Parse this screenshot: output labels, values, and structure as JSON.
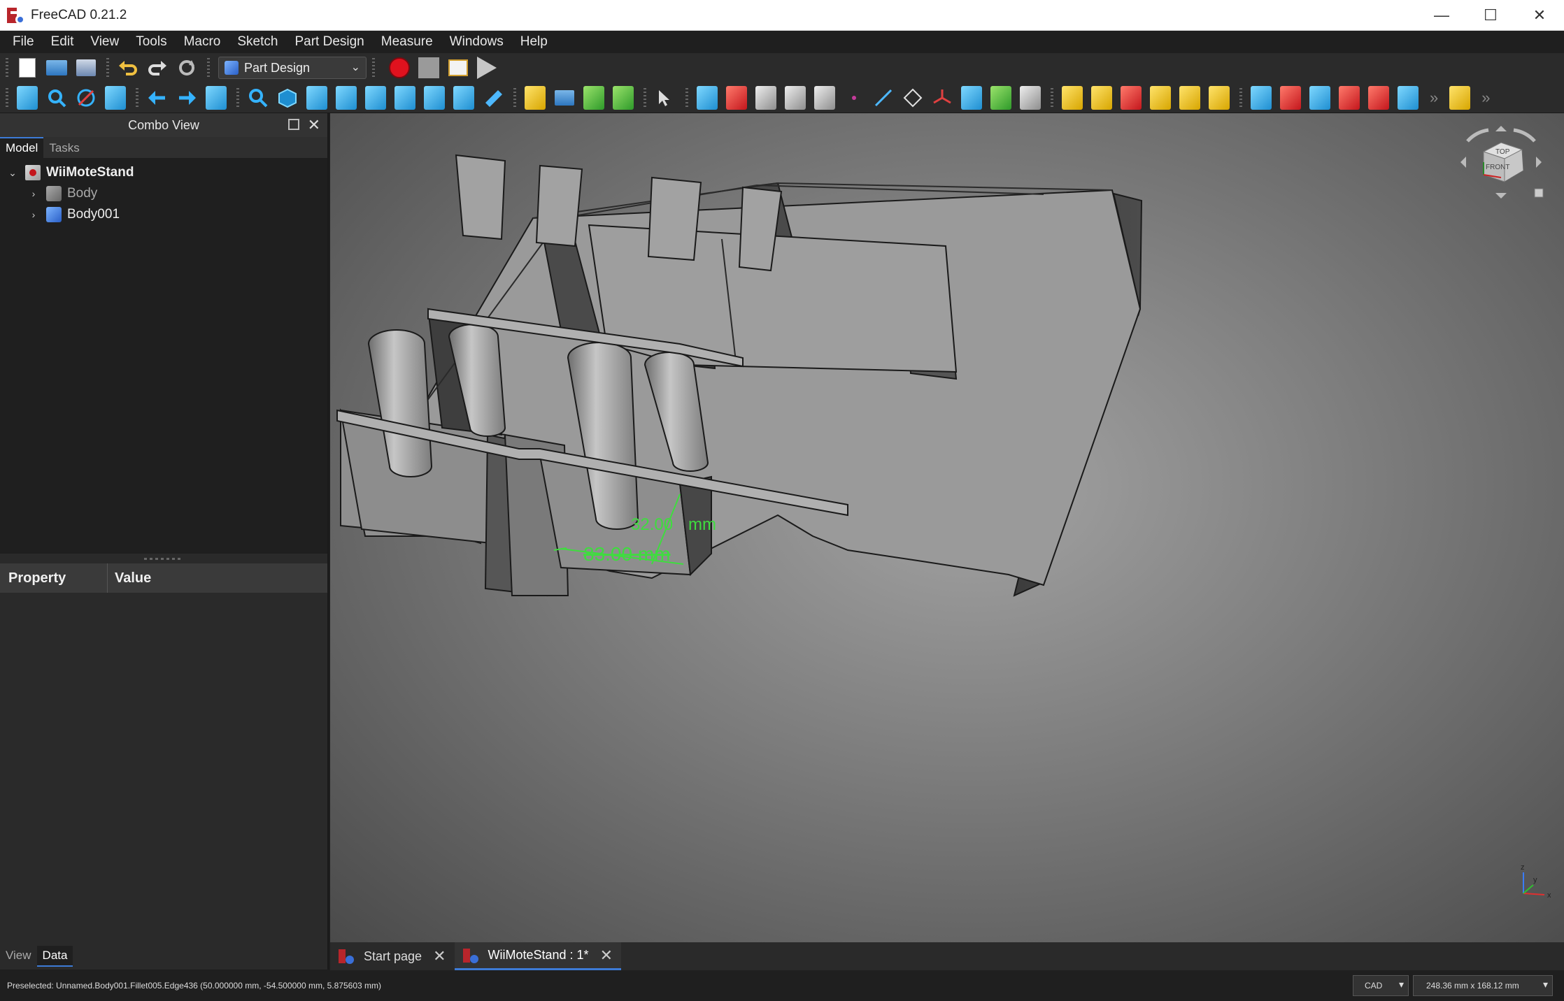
{
  "window": {
    "title": "FreeCAD 0.21.2",
    "controls": [
      "—",
      "☐",
      "✕"
    ]
  },
  "menu": [
    "File",
    "Edit",
    "View",
    "Tools",
    "Macro",
    "Sketch",
    "Part Design",
    "Measure",
    "Windows",
    "Help"
  ],
  "toolbar": {
    "workbench": "Part Design"
  },
  "combo": {
    "title": "Combo View",
    "tabs": [
      "Model",
      "Tasks"
    ],
    "tree": [
      {
        "label": "WiiMoteStand",
        "type": "document"
      },
      {
        "label": "Body",
        "type": "body-inactive"
      },
      {
        "label": "Body001",
        "type": "body"
      }
    ],
    "property_header": [
      "Property",
      "Value"
    ],
    "bottom_tabs": [
      "View",
      "Data"
    ]
  },
  "viewport": {
    "navcube": {
      "top": "TOP",
      "front": "FRONT"
    },
    "dimension_1": "32.00",
    "dimension_unit": "mm",
    "dimension_2": "83.00 mm",
    "axis_labels": [
      "z",
      "y",
      "x"
    ]
  },
  "doc_tabs": [
    {
      "label": "Start page"
    },
    {
      "label": "WiiMoteStand : 1*"
    }
  ],
  "status": {
    "preselected": "Preselected: Unnamed.Body001.Fillet005.Edge436 (50.000000 mm, -54.500000 mm, 5.875603 mm)",
    "nav_style": "CAD",
    "dimensions": "248.36 mm x 168.12 mm"
  },
  "colors": {
    "accent": "#3d7bd6",
    "dimension": "#3fdc3f",
    "record": "#e0121e"
  }
}
